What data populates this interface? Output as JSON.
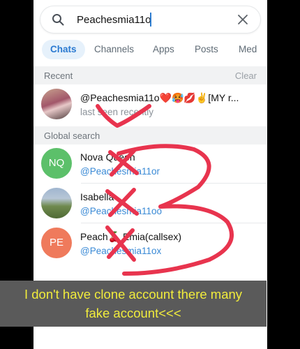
{
  "search": {
    "value": "Peachesmia11o"
  },
  "tabs": [
    "Chats",
    "Channels",
    "Apps",
    "Posts",
    "Med"
  ],
  "recent": {
    "header": "Recent",
    "clear_label": "Clear",
    "item": {
      "name": "@Peachesmia11o❤️🥵💋✌️[MY r...",
      "status": "last seen recently"
    }
  },
  "global": {
    "header": "Global search",
    "items": [
      {
        "avatar_text": "NQ",
        "avatar_color": "#5cc06a",
        "name": "Nova Queen",
        "username": "@Peachesmia11or"
      },
      {
        "avatar_text": "",
        "avatar_color": "#7e9a5e",
        "name": "Isabella",
        "username": "@Peachesmia11oo"
      },
      {
        "avatar_text": "PE",
        "avatar_color": "#ef7a5c",
        "name": "Peach🍒 Emia(callsex)",
        "username": "@Peachesmia11ox"
      }
    ]
  },
  "caption": {
    "line1": "I don't have clone account there many",
    "line2": "fake account<<<"
  },
  "colors": {
    "accent": "#2b7ad1",
    "scribble": "#e8344e",
    "caption_text": "#f1ec3c"
  }
}
